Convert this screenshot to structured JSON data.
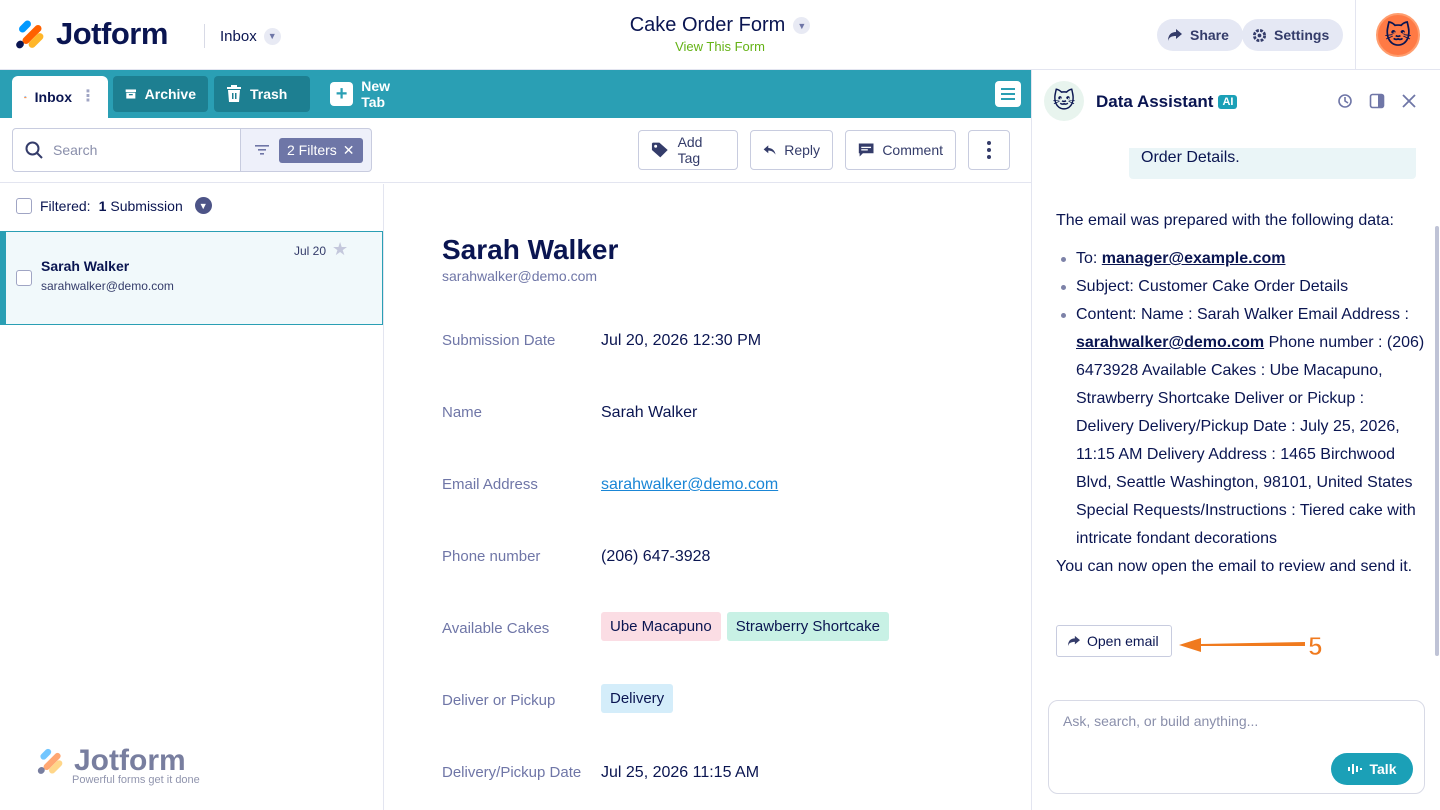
{
  "brand": {
    "name": "Jotform",
    "tagline": "Powerful forms get it done"
  },
  "nav": {
    "inbox_label": "Inbox"
  },
  "form": {
    "title": "Cake Order Form",
    "view_link": "View This Form"
  },
  "header_buttons": {
    "share": "Share",
    "settings": "Settings"
  },
  "tabs": [
    {
      "label": "Inbox"
    },
    {
      "label": "Archive"
    },
    {
      "label": "Trash"
    },
    {
      "label": "New Tab"
    }
  ],
  "toolbar": {
    "search_placeholder": "Search",
    "filters_label": "2 Filters",
    "add_tag": "Add Tag",
    "reply": "Reply",
    "comment": "Comment"
  },
  "list": {
    "filtered_prefix": "Filtered:",
    "filtered_count": "1",
    "filtered_suffix": "Submission",
    "items": [
      {
        "name": "Sarah Walker",
        "email": "sarahwalker@demo.com",
        "date": "Jul 20"
      }
    ]
  },
  "detail": {
    "name": "Sarah Walker",
    "email": "sarahwalker@demo.com",
    "fields": [
      {
        "label": "Submission Date",
        "value": "Jul 20, 2026 12:30 PM"
      },
      {
        "label": "Name",
        "value": "Sarah Walker"
      },
      {
        "label": "Email Address",
        "value": "sarahwalker@demo.com"
      },
      {
        "label": "Phone number",
        "value": "(206) 647-3928"
      },
      {
        "label": "Available Cakes",
        "tags": [
          "Ube Macapuno",
          "Strawberry Shortcake"
        ]
      },
      {
        "label": "Deliver or Pickup",
        "tags": [
          "Delivery"
        ]
      },
      {
        "label": "Delivery/Pickup Date",
        "value": "Jul 25, 2026 11:15 AM"
      }
    ],
    "tag_colors": {
      "Ube Macapuno": "#fbdde4",
      "Strawberry Shortcake": "#c8f1e5",
      "Delivery": "#d4edfa"
    }
  },
  "assistant": {
    "title": "Data Assistant",
    "badge": "AI",
    "user_bubble": "Order Details.",
    "intro": "The email was prepared with the following data:",
    "to_label": "To:",
    "to_value": "manager@example.com",
    "subject_label": "Subject:",
    "subject_value": "Customer Cake Order Details",
    "content_label": "Content:",
    "content_part1": "Name : Sarah Walker Email Address :",
    "content_email": "sarahwalker@demo.com",
    "content_part2": "Phone number : (206) 6473928 Available Cakes : Ube Macapuno, Strawberry Shortcake Deliver or Pickup : Delivery Delivery/Pickup Date : July 25, 2026, 11:15 AM Delivery Address : 1465 Birchwood Blvd, Seattle Washington, 98101, United States Special Requests/Instructions : Tiered cake with intricate fondant decorations",
    "outro": "You can now open the email to review and send it.",
    "open_email": "Open email",
    "annotation_number": "5",
    "chat_placeholder": "Ask, search, or build anything...",
    "talk": "Talk"
  },
  "colors": {
    "accent": "#2a9fb4",
    "annotation": "#f07a1e",
    "navy": "#0a1551"
  }
}
